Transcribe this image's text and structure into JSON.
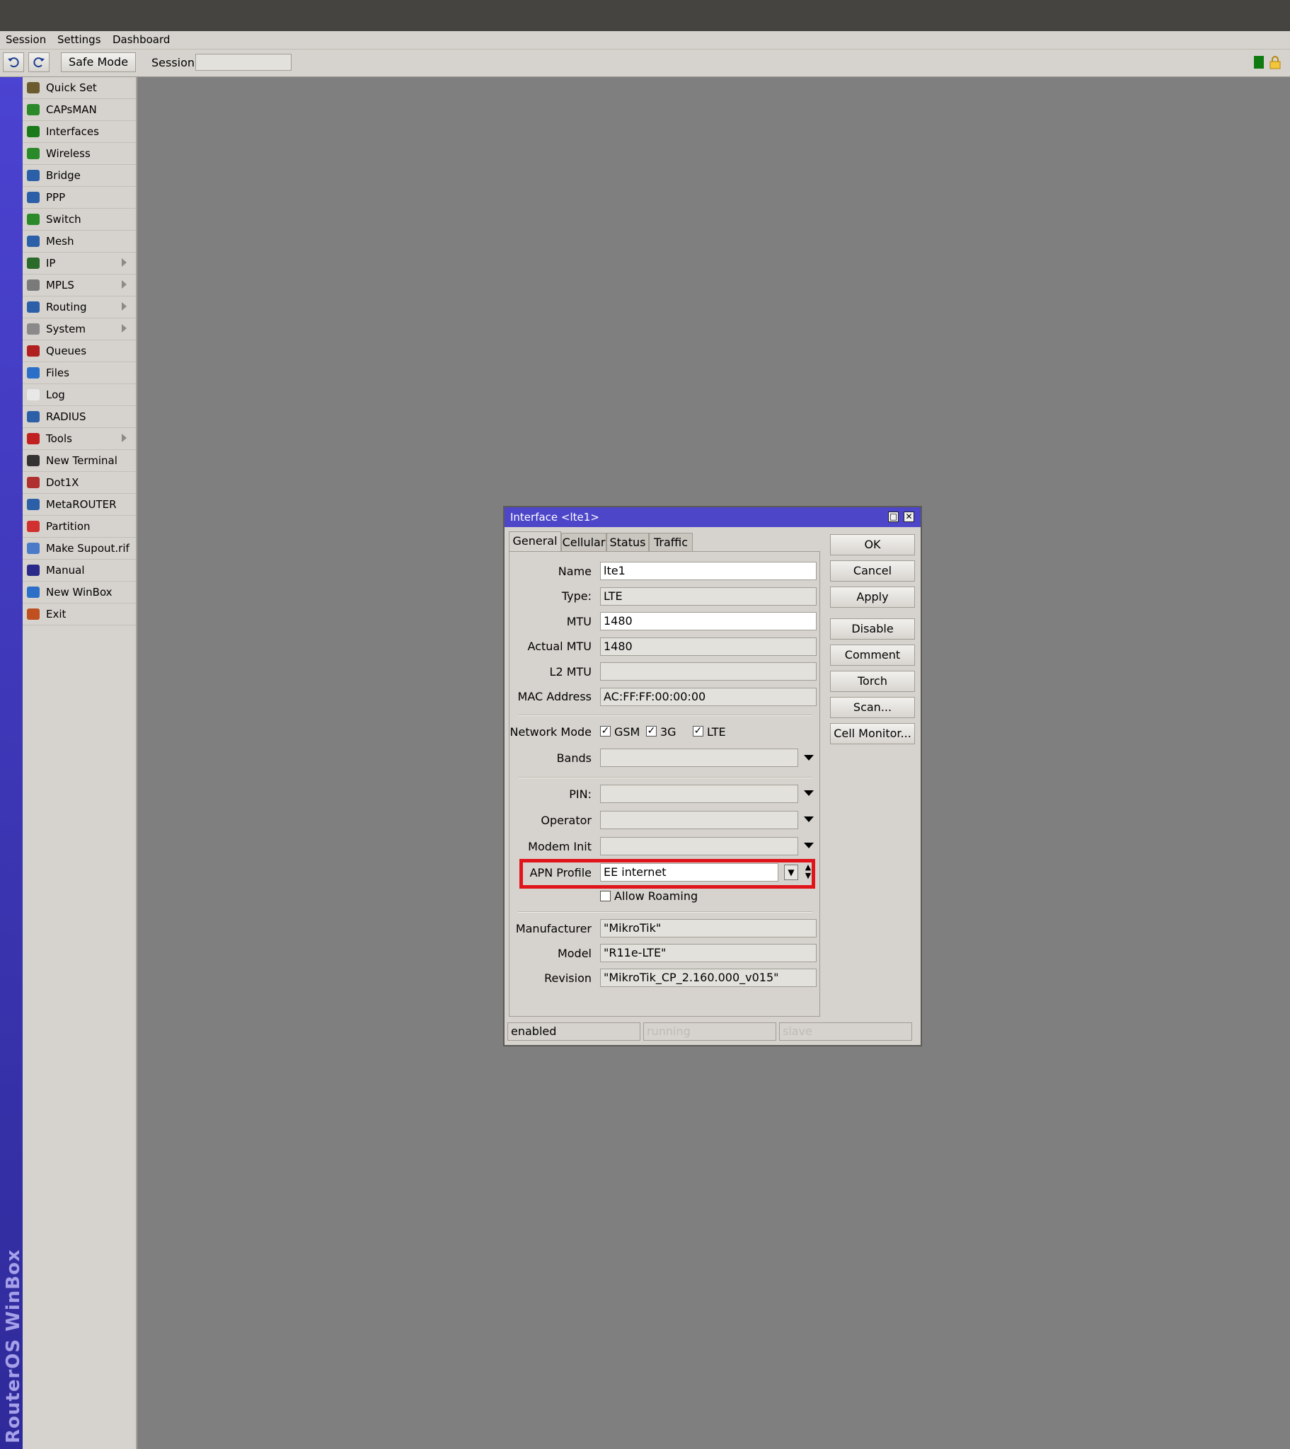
{
  "menu": {
    "session": "Session",
    "settings": "Settings",
    "dashboard": "Dashboard"
  },
  "toolbar": {
    "safe_mode": "Safe Mode",
    "session_label": "Session",
    "session_value": ""
  },
  "brand": "RouterOS WinBox",
  "sidebar": {
    "items": [
      {
        "label": "Quick Set",
        "icon": "wand-icon",
        "submenu": false
      },
      {
        "label": "CAPsMAN",
        "icon": "antenna-icon",
        "submenu": false
      },
      {
        "label": "Interfaces",
        "icon": "network-card-icon",
        "submenu": false
      },
      {
        "label": "Wireless",
        "icon": "wireless-icon",
        "submenu": false
      },
      {
        "label": "Bridge",
        "icon": "bridge-icon",
        "submenu": false
      },
      {
        "label": "PPP",
        "icon": "ppp-icon",
        "submenu": false
      },
      {
        "label": "Switch",
        "icon": "switch-icon",
        "submenu": false
      },
      {
        "label": "Mesh",
        "icon": "mesh-icon",
        "submenu": false
      },
      {
        "label": "IP",
        "icon": "ip-icon",
        "submenu": true
      },
      {
        "label": "MPLS",
        "icon": "mpls-icon",
        "submenu": true
      },
      {
        "label": "Routing",
        "icon": "routing-icon",
        "submenu": true
      },
      {
        "label": "System",
        "icon": "gear-icon",
        "submenu": true
      },
      {
        "label": "Queues",
        "icon": "queues-icon",
        "submenu": false
      },
      {
        "label": "Files",
        "icon": "folder-icon",
        "submenu": false
      },
      {
        "label": "Log",
        "icon": "log-icon",
        "submenu": false
      },
      {
        "label": "RADIUS",
        "icon": "users-icon",
        "submenu": false
      },
      {
        "label": "Tools",
        "icon": "tools-icon",
        "submenu": true
      },
      {
        "label": "New Terminal",
        "icon": "terminal-icon",
        "submenu": false
      },
      {
        "label": "Dot1X",
        "icon": "dot1x-icon",
        "submenu": false
      },
      {
        "label": "MetaROUTER",
        "icon": "metarouter-icon",
        "submenu": false
      },
      {
        "label": "Partition",
        "icon": "partition-icon",
        "submenu": false
      },
      {
        "label": "Make Supout.rif",
        "icon": "supout-icon",
        "submenu": false
      },
      {
        "label": "Manual",
        "icon": "manual-icon",
        "submenu": false
      },
      {
        "label": "New WinBox",
        "icon": "winbox-icon",
        "submenu": false
      },
      {
        "label": "Exit",
        "icon": "exit-icon",
        "submenu": false
      }
    ]
  },
  "dialog": {
    "title": "Interface <lte1>",
    "tabs": [
      "General",
      "Cellular",
      "Status",
      "Traffic"
    ],
    "fields": {
      "name": {
        "label": "Name",
        "value": "lte1"
      },
      "type": {
        "label": "Type:",
        "value": "LTE"
      },
      "mtu": {
        "label": "MTU",
        "value": "1480"
      },
      "actual_mtu": {
        "label": "Actual MTU",
        "value": "1480"
      },
      "l2mtu": {
        "label": "L2 MTU",
        "value": ""
      },
      "mac": {
        "label": "MAC Address",
        "value": "AC:FF:FF:00:00:00"
      },
      "network_mode": {
        "label": "Network Mode",
        "options": [
          "GSM",
          "3G",
          "LTE"
        ]
      },
      "bands": {
        "label": "Bands",
        "value": ""
      },
      "pin": {
        "label": "PIN:",
        "value": ""
      },
      "operator": {
        "label": "Operator",
        "value": ""
      },
      "modem_init": {
        "label": "Modem Init",
        "value": ""
      },
      "apn_profile": {
        "label": "APN Profile",
        "value": "EE internet"
      },
      "allow_roaming": {
        "label": "Allow Roaming"
      },
      "manufacturer": {
        "label": "Manufacturer",
        "value": "\"MikroTik\""
      },
      "model": {
        "label": "Model",
        "value": "\"R11e-LTE\""
      },
      "revision": {
        "label": "Revision",
        "value": "\"MikroTik_CP_2.160.000_v015\""
      }
    },
    "buttons": {
      "ok": "OK",
      "cancel": "Cancel",
      "apply": "Apply",
      "disable": "Disable",
      "comment": "Comment",
      "torch": "Torch",
      "scan": "Scan...",
      "cell_monitor": "Cell Monitor..."
    },
    "status": {
      "enabled": "enabled",
      "running": "running",
      "slave": "slave"
    }
  },
  "colors": {
    "title_bar": "#4d46c9",
    "highlight": "#e0141a",
    "status_ok": "#0f7a0f"
  }
}
